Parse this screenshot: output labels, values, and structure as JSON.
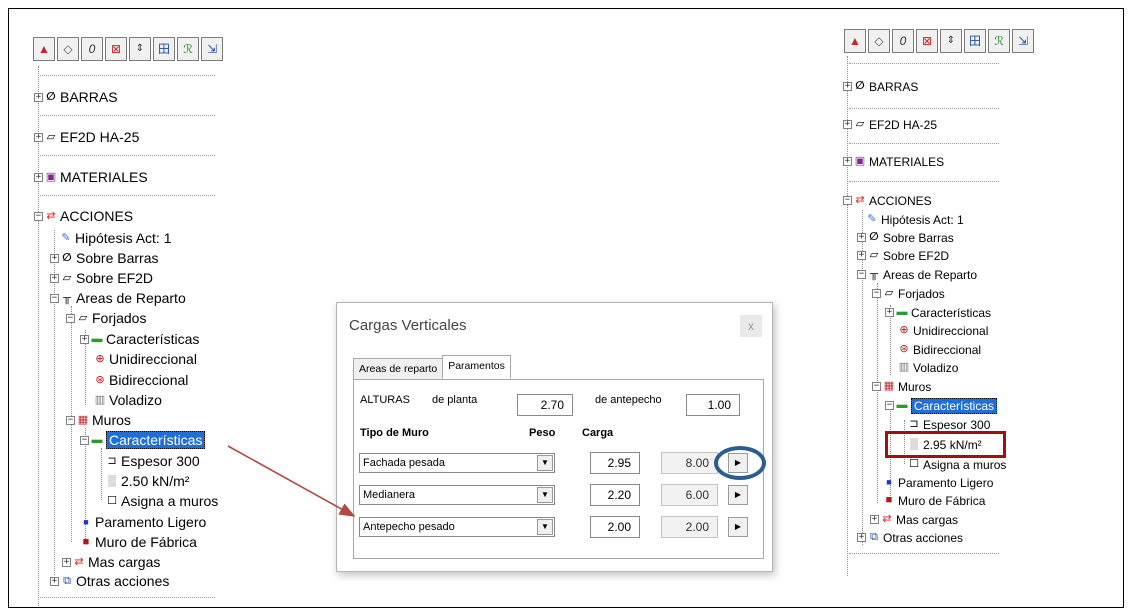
{
  "toolbar_icons": [
    "loads-icon",
    "tag-icon",
    "bar-icon",
    "delete-loads-icon",
    "spinner-icon",
    "grid-icon",
    "group-icon",
    "export-icon"
  ],
  "left_tree": {
    "barras": "BARRAS",
    "ef2d": "EF2D HA-25",
    "materiales": "MATERIALES",
    "acciones": "ACCIONES",
    "hipotesis": "Hipótesis Act: 1",
    "sobre_barras": "Sobre Barras",
    "sobre_ef2d": "Sobre EF2D",
    "areas_reparto": "Areas de Reparto",
    "forjados": "Forjados",
    "caracteristicas_forjados": "Características",
    "unidireccional": "Unidireccional",
    "bidireccional": "Bidireccional",
    "voladizo": "Voladizo",
    "muros": "Muros",
    "caracteristicas_muros": "Características",
    "espesor": "Espesor 300",
    "carga": "2.50 kN/m²",
    "asigna": "Asigna a muros",
    "paramento": "Paramento Ligero",
    "muro_fabrica": "Muro de Fábrica",
    "mas_cargas": "Mas cargas",
    "otras": "Otras acciones"
  },
  "right_tree": {
    "barras": "BARRAS",
    "ef2d": "EF2D HA-25",
    "materiales": "MATERIALES",
    "acciones": "ACCIONES",
    "hipotesis": "Hipótesis Act: 1",
    "sobre_barras": "Sobre Barras",
    "sobre_ef2d": "Sobre EF2D",
    "areas_reparto": "Areas de Reparto",
    "forjados": "Forjados",
    "caracteristicas_forjados": "Características",
    "unidireccional": "Unidireccional",
    "bidireccional": "Bidireccional",
    "voladizo": "Voladizo",
    "muros": "Muros",
    "caracteristicas_muros": "Características",
    "espesor": "Espesor 300",
    "carga": "2.95 kN/m²",
    "asigna": "Asigna a muros",
    "paramento": "Paramento Ligero",
    "muro_fabrica": "Muro de Fábrica",
    "mas_cargas": "Mas cargas",
    "otras": "Otras acciones"
  },
  "dialog": {
    "title": "Cargas Verticales",
    "close": "x",
    "tabs": [
      "Areas de reparto",
      "Paramentos"
    ],
    "alturas": "ALTURAS",
    "de_planta": "de planta",
    "planta_value": "2.70",
    "de_antepecho": "de antepecho",
    "antepecho_value": "1.00",
    "col_tipo": "Tipo de Muro",
    "col_peso": "Peso",
    "col_carga": "Carga",
    "rows": [
      {
        "tipo": "Fachada pesada",
        "peso": "2.95",
        "carga": "8.00"
      },
      {
        "tipo": "Medianera",
        "peso": "2.20",
        "carga": "6.00"
      },
      {
        "tipo": "Antepecho pesado",
        "peso": "2.00",
        "carga": "2.00"
      }
    ]
  },
  "colors": {
    "selection": "#1f6fd6",
    "arrow": "#b04a45",
    "circle": "#2b5c92",
    "highlight_box": "#a01010"
  }
}
